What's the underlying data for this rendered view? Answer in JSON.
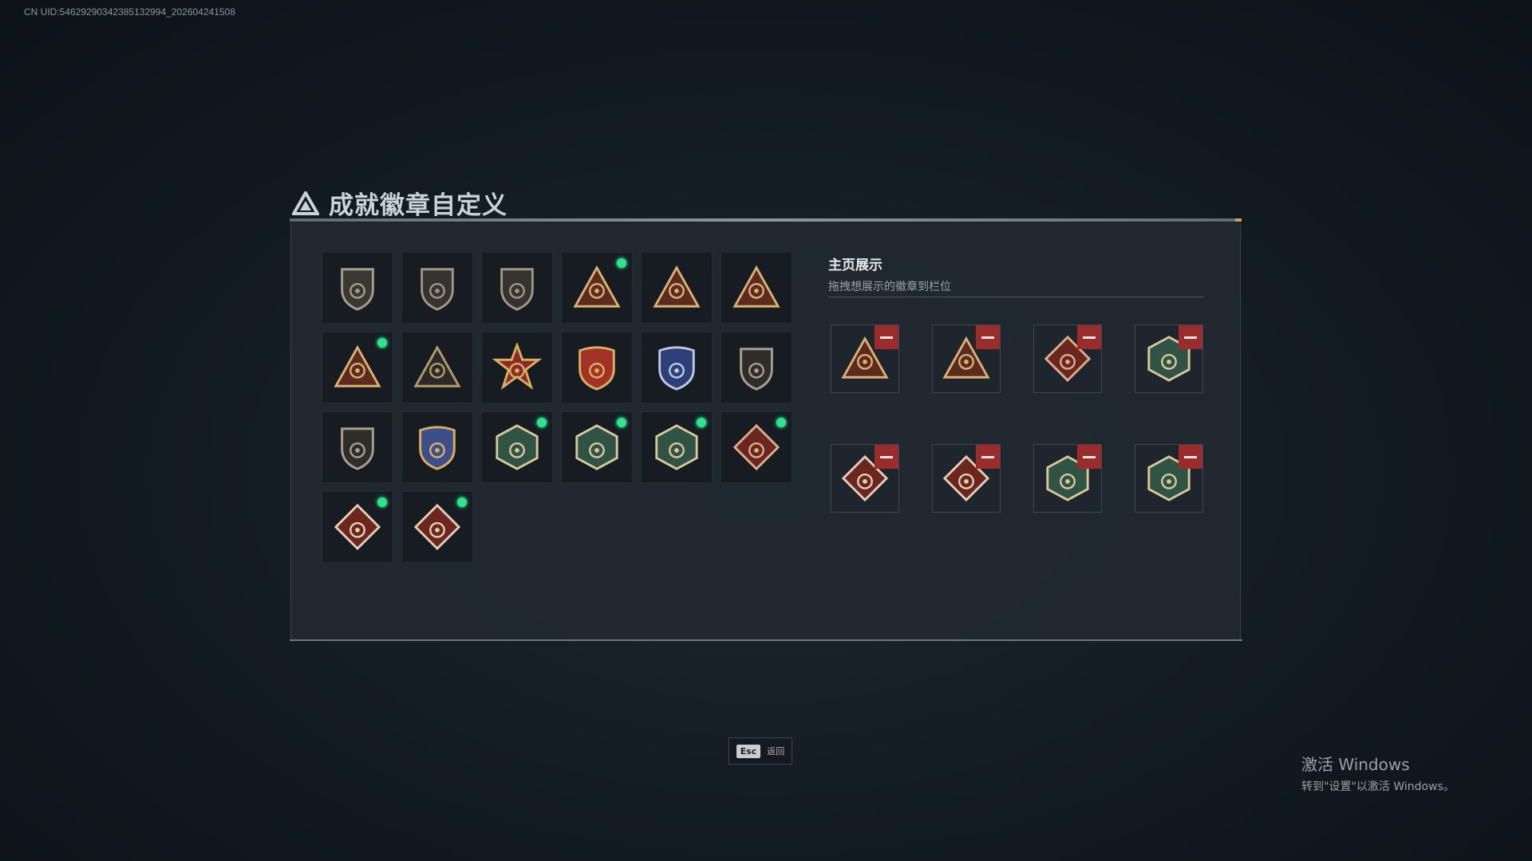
{
  "uid_text": "CN UID:546292903423851329​94_202604241508",
  "page_title": "成就徽章自定义",
  "badges": [
    {
      "icon": "tri-shield-emblem",
      "frame": "shield",
      "fill": "#3a3833",
      "color": "#a59d8e",
      "dot": false
    },
    {
      "icon": "helicopter-emblem",
      "frame": "shield",
      "fill": "#35332f",
      "color": "#9f9684",
      "dot": false
    },
    {
      "icon": "dagger-shield-emblem",
      "frame": "shield",
      "fill": "#35332f",
      "color": "#9f9684",
      "dot": false
    },
    {
      "icon": "sb-triangle-emblem",
      "frame": "triangle",
      "fill": "#5e2a1e",
      "color": "#d6b274",
      "dot": true
    },
    {
      "icon": "boat-triangle-emblem",
      "frame": "triangle",
      "fill": "#5e2a1e",
      "color": "#d6b274",
      "dot": false
    },
    {
      "icon": "number-one-triangle-emblem",
      "frame": "triangle",
      "fill": "#5e2a1e",
      "color": "#d6b274",
      "dot": false
    },
    {
      "icon": "usb-triangle-emblem",
      "frame": "triangle",
      "fill": "#5e2a1e",
      "color": "#d6b274",
      "dot": true
    },
    {
      "icon": "squad-triangle-emblem",
      "frame": "triangle",
      "fill": "#2b2a28",
      "color": "#b39b6a",
      "dot": false
    },
    {
      "icon": "star-medal-emblem",
      "frame": "star",
      "fill": "#8b2a2a",
      "color": "#d8b060",
      "dot": false
    },
    {
      "icon": "eagle-crest-emblem",
      "frame": "crest",
      "fill": "#a23126",
      "color": "#d8b060",
      "dot": false
    },
    {
      "icon": "diamond-crest-emblem",
      "frame": "crest",
      "fill": "#2c3f78",
      "color": "#bfc8dd",
      "dot": false
    },
    {
      "icon": "no-gun-shield-emblem",
      "frame": "shield",
      "fill": "#2f2d2a",
      "color": "#a8a08c",
      "dot": false
    },
    {
      "icon": "no-rifle-shield-emblem",
      "frame": "shield",
      "fill": "#2f2d2a",
      "color": "#a8a08c",
      "dot": false
    },
    {
      "icon": "winged-crest-emblem",
      "frame": "crest",
      "fill": "#3c4f8a",
      "color": "#d8b060",
      "dot": false
    },
    {
      "icon": "wasp-hex-emblem",
      "frame": "hex",
      "fill": "#2f5446",
      "color": "#d9c79a",
      "dot": true
    },
    {
      "icon": "wasp-hex-emblem",
      "frame": "hex",
      "fill": "#2f5446",
      "color": "#d9c79a",
      "dot": true
    },
    {
      "icon": "drone-hex-emblem",
      "frame": "hex",
      "fill": "#2f5446",
      "color": "#d9c79a",
      "dot": true
    },
    {
      "icon": "dragon-diamond-emblem",
      "frame": "diamond",
      "fill": "#6b2620",
      "color": "#d9b08a",
      "dot": true
    },
    {
      "icon": "runner-diamond-emblem",
      "frame": "diamond",
      "fill": "#6b2620",
      "color": "#e3cfb4",
      "dot": true
    },
    {
      "icon": "medic-diamond-emblem",
      "frame": "diamond",
      "fill": "#6b2620",
      "color": "#e3cfb4",
      "dot": true
    }
  ],
  "showcase": {
    "title": "主页展示",
    "subtitle": "拖拽想展示的徽章到栏位",
    "slots": [
      {
        "icon": "sb-triangle-emblem",
        "frame": "triangle",
        "fill": "#5e2a1e",
        "color": "#d6b274"
      },
      {
        "icon": "usb-triangle-emblem",
        "frame": "triangle",
        "fill": "#5e2a1e",
        "color": "#d6b274"
      },
      {
        "icon": "dragon-diamond-emblem",
        "frame": "diamond",
        "fill": "#6b2620",
        "color": "#d9b08a"
      },
      {
        "icon": "wasp-hex-emblem",
        "frame": "hex",
        "fill": "#2f5446",
        "color": "#d9c79a"
      },
      {
        "icon": "medic-diamond-emblem",
        "frame": "diamond",
        "fill": "#6b2620",
        "color": "#e3cfb4"
      },
      {
        "icon": "runner-diamond-emblem",
        "frame": "diamond",
        "fill": "#6b2620",
        "color": "#e3cfb4"
      },
      {
        "icon": "drone-hex-emblem",
        "frame": "hex",
        "fill": "#2f5446",
        "color": "#d9c79a"
      },
      {
        "icon": "wasp-hex-emblem",
        "frame": "hex",
        "fill": "#2f5446",
        "color": "#d9c79a"
      }
    ]
  },
  "footer": {
    "esc_key": "Esc",
    "esc_label": "返回"
  },
  "watermark": {
    "line1": "激活 Windows",
    "line2": "转到\"设置\"以激活 Windows。"
  },
  "colors": {
    "new_dot": "#33e08d",
    "remove_button": "#9a2c2c",
    "accent": "#c8a35a"
  }
}
